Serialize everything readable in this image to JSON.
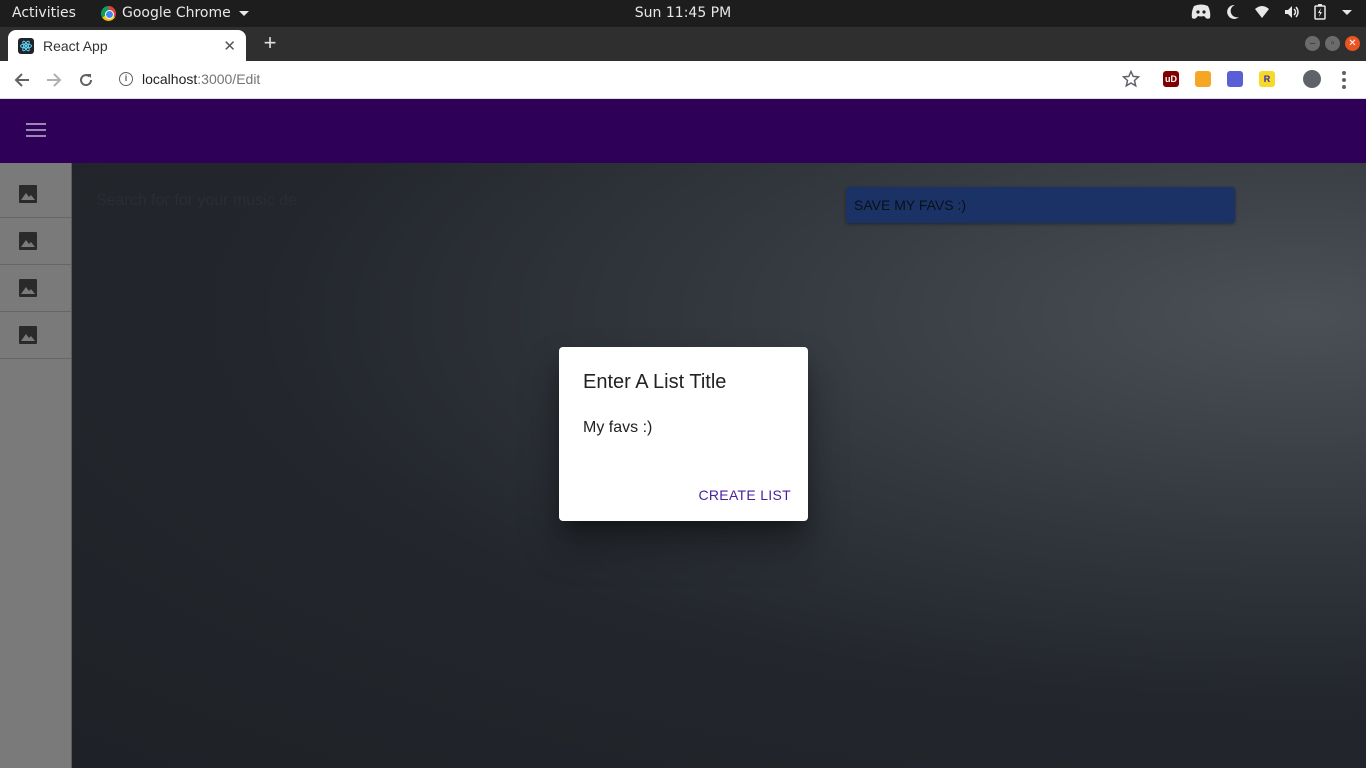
{
  "os_bar": {
    "activities": "Activities",
    "app_name": "Google Chrome",
    "clock": "Sun 11:45 PM"
  },
  "browser": {
    "tab_title": "React App",
    "url_host": "localhost",
    "url_path": ":3000/Edit",
    "extensions": [
      {
        "name": "ublock-icon",
        "label": "uD",
        "color": "#8b0000"
      },
      {
        "name": "honey-icon",
        "label": "",
        "color": "#f5a623"
      },
      {
        "name": "reader-icon",
        "label": "",
        "color": "#5b5fd6"
      },
      {
        "name": "r-extension-icon",
        "label": "R",
        "color": "#f6d92b"
      }
    ]
  },
  "app": {
    "search_text": "Search for for your music de",
    "save_button": "SAVE MY FAVS :)",
    "sidebar_items": [
      "image-icon",
      "image-icon",
      "image-icon",
      "image-icon"
    ],
    "appbar_color": "#2e0058"
  },
  "dialog": {
    "title": "Enter A List Title",
    "value": "My favs :)",
    "action": "CREATE LIST"
  }
}
